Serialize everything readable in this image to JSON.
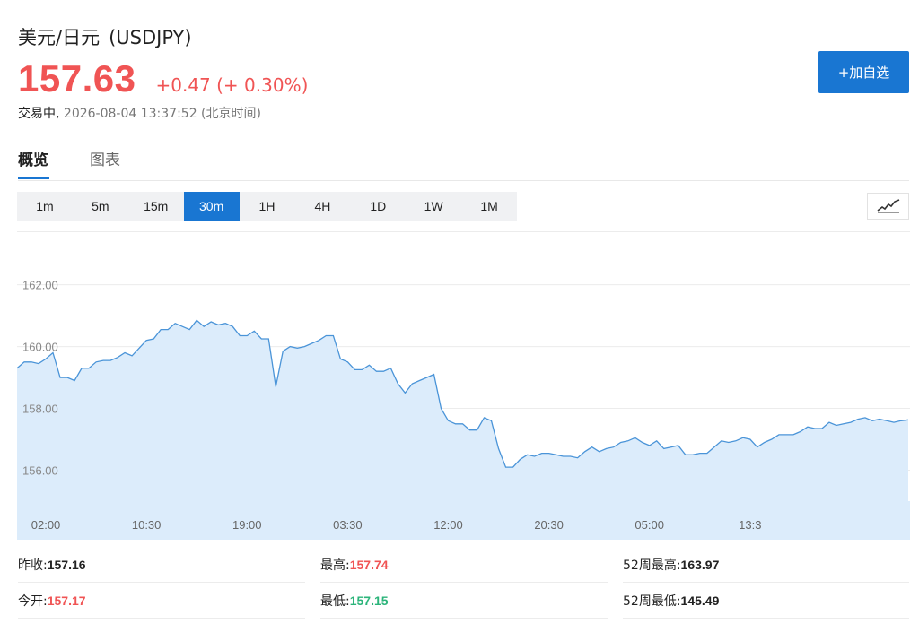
{
  "header": {
    "name": "美元/日元",
    "symbol": "(USDJPY)",
    "price": "157.63",
    "change": "+0.47 (+ 0.30%)",
    "status": "交易中,",
    "timestamp": "2026-08-04 13:37:52 (北京时间)",
    "add_button": "+加自选"
  },
  "tabs": [
    {
      "label": "概览",
      "active": true
    },
    {
      "label": "图表",
      "active": false
    }
  ],
  "ranges": [
    {
      "label": "1m"
    },
    {
      "label": "5m"
    },
    {
      "label": "15m"
    },
    {
      "label": "30m",
      "active": true
    },
    {
      "label": "1H"
    },
    {
      "label": "4H"
    },
    {
      "label": "1D"
    },
    {
      "label": "1W"
    },
    {
      "label": "1M"
    }
  ],
  "colors": {
    "up": "#f05454",
    "down": "#2bb47a",
    "accent": "#1976d2",
    "line": "#4a94d8",
    "area": "#dcecfb"
  },
  "chart_data": {
    "type": "area",
    "ylim": [
      155.0,
      163.7
    ],
    "y_ticks": [
      156.0,
      158.0,
      160.0,
      162.0
    ],
    "y_tick_labels": [
      "156.00",
      "158.00",
      "160.00",
      "162.00"
    ],
    "x_ticks": [
      4,
      18,
      32,
      46,
      60,
      74,
      88,
      102
    ],
    "x_tick_labels": [
      "02:00",
      "10:30",
      "19:00",
      "03:30",
      "12:00",
      "20:30",
      "05:00",
      "13:3"
    ],
    "grid": true,
    "series": [
      {
        "values": [
          159.3,
          159.5,
          159.5,
          159.45,
          159.6,
          159.8,
          159.0,
          159.0,
          158.9,
          159.3,
          159.3,
          159.5,
          159.55,
          159.55,
          159.65,
          159.8,
          159.7,
          159.95,
          160.2,
          160.25,
          160.55,
          160.55,
          160.75,
          160.65,
          160.55,
          160.85,
          160.65,
          160.8,
          160.7,
          160.75,
          160.65,
          160.35,
          160.35,
          160.5,
          160.25,
          160.25,
          158.7,
          159.85,
          160.0,
          159.95,
          160.0,
          160.1,
          160.2,
          160.35,
          160.35,
          159.6,
          159.5,
          159.25,
          159.25,
          159.4,
          159.2,
          159.2,
          159.3,
          158.8,
          158.5,
          158.8,
          158.9,
          159.0,
          159.1,
          158.0,
          157.6,
          157.5,
          157.5,
          157.3,
          157.3,
          157.7,
          157.6,
          156.7,
          156.1,
          156.1,
          156.35,
          156.5,
          156.45,
          156.55,
          156.55,
          156.5,
          156.45,
          156.45,
          156.4,
          156.6,
          156.75,
          156.6,
          156.7,
          156.75,
          156.9,
          156.95,
          157.05,
          156.9,
          156.8,
          156.95,
          156.7,
          156.75,
          156.8,
          156.5,
          156.5,
          156.55,
          156.55,
          156.75,
          156.95,
          156.9,
          156.95,
          157.05,
          157.0,
          156.75,
          156.9,
          157.0,
          157.15,
          157.15,
          157.15,
          157.25,
          157.4,
          157.35,
          157.35,
          157.55,
          157.45,
          157.5,
          157.55,
          157.65,
          157.7,
          157.6,
          157.65,
          157.6,
          157.55,
          157.6,
          157.63
        ]
      }
    ]
  },
  "stats": [
    [
      {
        "label": "昨收:",
        "value": "157.16",
        "tone": "neutral"
      },
      {
        "label": "最高:",
        "value": "157.74",
        "tone": "up"
      },
      {
        "label": "52周最高:",
        "value": "163.97",
        "tone": "neutral"
      }
    ],
    [
      {
        "label": "今开:",
        "value": "157.17",
        "tone": "up"
      },
      {
        "label": "最低:",
        "value": "157.15",
        "tone": "down"
      },
      {
        "label": "52周最低:",
        "value": "145.49",
        "tone": "neutral"
      }
    ]
  ]
}
